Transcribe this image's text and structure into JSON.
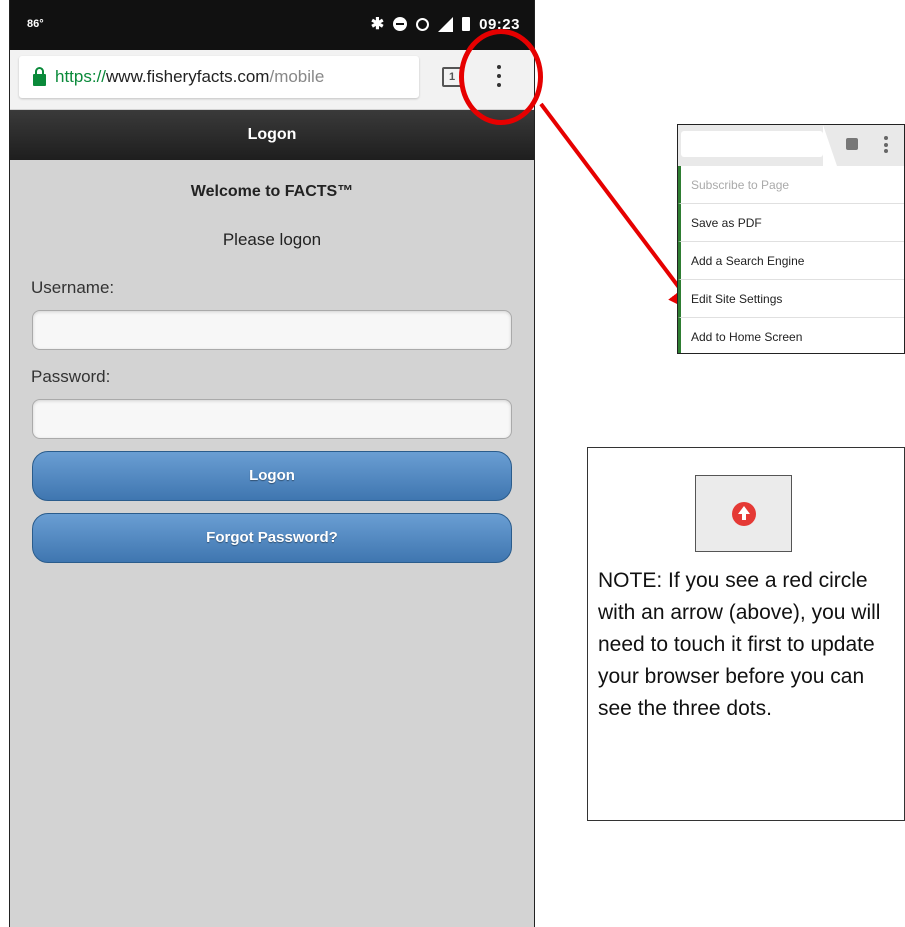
{
  "status_bar": {
    "left_text": "86°",
    "time": "09:23",
    "icons": [
      "bluetooth-icon",
      "do-not-disturb-icon",
      "alarm-icon",
      "signal-icon",
      "battery-icon"
    ]
  },
  "url_bar": {
    "scheme": "https://",
    "host": "www.fisheryfacts.com",
    "path": "/mobile",
    "tab_count": "1"
  },
  "header": {
    "title": "Logon"
  },
  "login": {
    "welcome": "Welcome to FACTS™",
    "prompt": "Please logon",
    "username_label": "Username:",
    "username_value": "",
    "password_label": "Password:",
    "password_value": "",
    "logon_button": "Logon",
    "forgot_button": "Forgot Password?"
  },
  "menu_inset": {
    "items": [
      {
        "label": "Subscribe to Page",
        "enabled": false
      },
      {
        "label": "Save as PDF",
        "enabled": true
      },
      {
        "label": "Add a Search Engine",
        "enabled": true
      },
      {
        "label": "Edit Site Settings",
        "enabled": true
      },
      {
        "label": "Add to Home Screen",
        "enabled": true
      }
    ]
  },
  "note": {
    "text": "NOTE:  If you see a red circle with an arrow (above), you will need to touch it first to update your browser before you can see the three dots."
  },
  "colors": {
    "annotation_red": "#e60000",
    "button_blue": "#4a86c1",
    "secure_green": "#0a8a3a"
  }
}
